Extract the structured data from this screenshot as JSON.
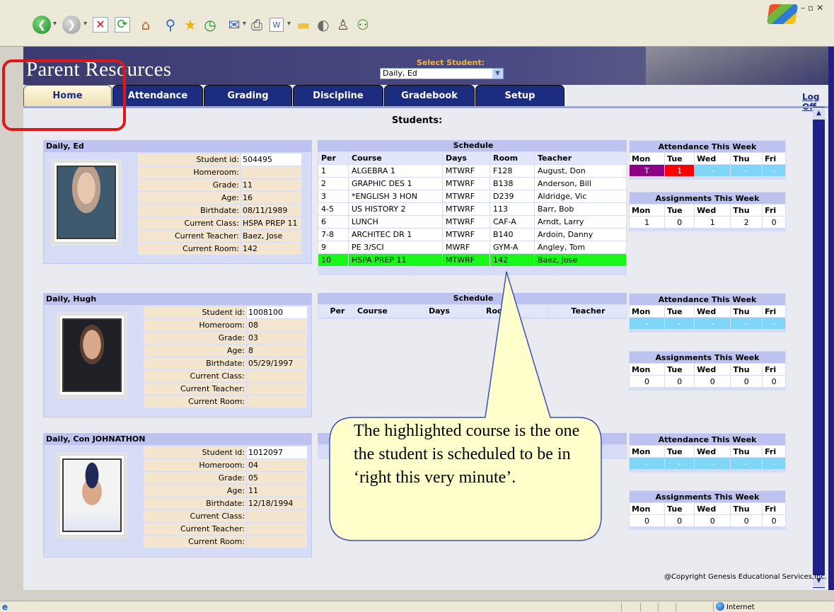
{
  "browser": {
    "toolbar_icons": [
      "back-icon",
      "forward-icon",
      "stop-icon",
      "refresh-icon",
      "home-icon",
      "search-icon",
      "favorites-icon",
      "history-icon",
      "mail-icon",
      "print-icon",
      "edit-icon",
      "folder-icon",
      "messenger-icon",
      "users-icon",
      "windows-logo-icon"
    ],
    "status_zone": "Internet"
  },
  "header": {
    "title": "Parent Resources",
    "select_label": "Select Student:",
    "selected_student": "Daily, Ed"
  },
  "tabs": [
    {
      "label": "Home",
      "active": true
    },
    {
      "label": "Attendance",
      "active": false
    },
    {
      "label": "Grading",
      "active": false
    },
    {
      "label": "Discipline",
      "active": false
    },
    {
      "label": "Gradebook",
      "active": false
    },
    {
      "label": "Setup",
      "active": false
    }
  ],
  "logoff": "Log Off",
  "students_heading": "Students:",
  "attendance_title": "Attendance This Week",
  "assignments_title": "Assignments This Week",
  "schedule_title": "Schedule",
  "weekdays": [
    "Mon",
    "Tue",
    "Wed",
    "Thu",
    "Fri"
  ],
  "schedule_headers": [
    "Per",
    "Course",
    "Days",
    "Room",
    "Teacher"
  ],
  "info_labels": [
    "Student id:",
    "Homeroom:",
    "Grade:",
    "Age:",
    "Birthdate:",
    "Current Class:",
    "Current Teacher:",
    "Current Room:"
  ],
  "students": [
    {
      "name": "Daily, Ed",
      "info": [
        "504495",
        "",
        "11",
        "16",
        "08/11/1989",
        "HSPA PREP 11",
        "Baez, Jose",
        "142"
      ],
      "schedule": [
        [
          "1",
          "ALGEBRA 1",
          "MTWRF",
          "F128",
          "August, Don"
        ],
        [
          "2",
          "GRAPHIC DES 1",
          "MTWRF",
          "B138",
          "Anderson, Bill"
        ],
        [
          "3",
          "*ENGLISH 3 HON",
          "MTWRF",
          "D239",
          "Aldridge, Vic"
        ],
        [
          "4-5",
          "US HISTORY 2",
          "MTWRF",
          "113",
          "Barr, Bob"
        ],
        [
          "6",
          "LUNCH",
          "MTWRF",
          "CAF-A",
          "Arndt, Larry"
        ],
        [
          "7-8",
          "ARCHITEC DR 1",
          "MTWRF",
          "B140",
          "Ardoin, Danny"
        ],
        [
          "9",
          "PE 3/SCI",
          "MWRF",
          "GYM-A",
          "Angley, Tom"
        ],
        [
          "10",
          "HSPA PREP 11",
          "MTWRF",
          "142",
          "Baez, Jose"
        ]
      ],
      "highlighted_period": "10",
      "attendance": [
        "T",
        "1",
        "-",
        "-",
        "-"
      ],
      "assignments": [
        "1",
        "0",
        "1",
        "2",
        "0"
      ]
    },
    {
      "name": "Daily, Hugh",
      "info": [
        "1008100",
        "08",
        "03",
        "8",
        "05/29/1997",
        "",
        "",
        ""
      ],
      "schedule": [],
      "attendance": [
        "-",
        "-",
        "-",
        "-",
        "-"
      ],
      "assignments": [
        "0",
        "0",
        "0",
        "0",
        "0"
      ]
    },
    {
      "name": "Daily, Con JOHNATHON",
      "info": [
        "1012097",
        "04",
        "05",
        "11",
        "12/18/1994",
        "",
        "",
        ""
      ],
      "schedule": [],
      "attendance": [
        "-",
        "-",
        "-",
        "-",
        "-"
      ],
      "assignments": [
        "0",
        "0",
        "0",
        "0",
        "0"
      ]
    }
  ],
  "copyright": "@Copyright Genesis Educational Services,Inc.",
  "callout_text": "The highlighted course is the one the student is scheduled to be in ‘right this very minute’."
}
